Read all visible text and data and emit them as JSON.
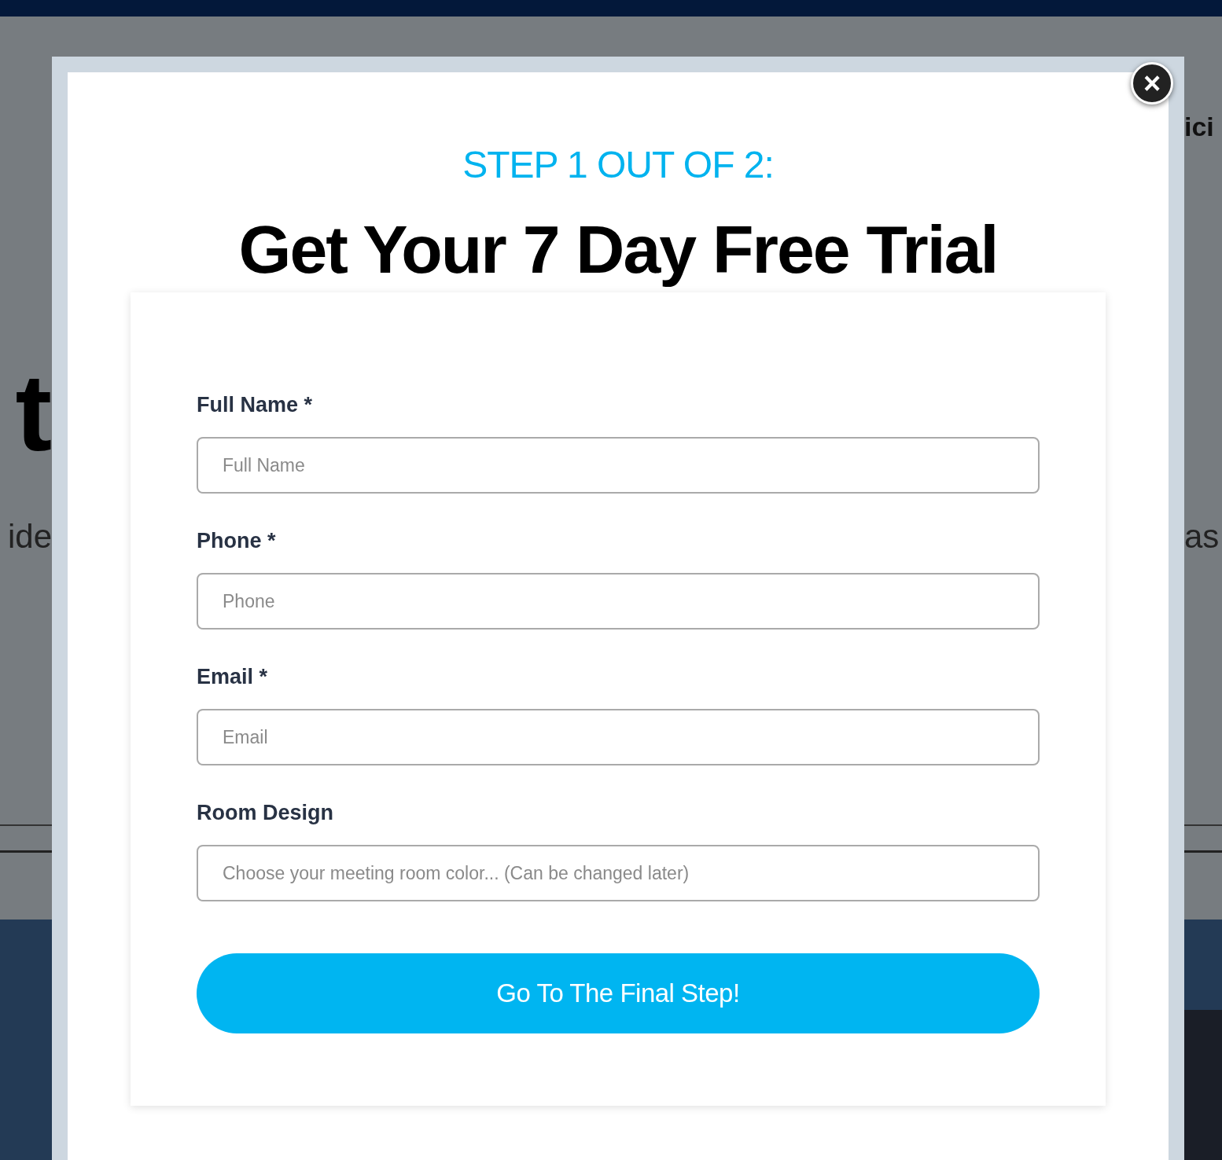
{
  "background_page": {
    "left_fragments": [
      {
        "kind": "headline",
        "text": "t"
      },
      {
        "kind": "body",
        "text": "ide"
      }
    ],
    "right_fragments": [
      {
        "kind": "nav",
        "text": "ici"
      },
      {
        "kind": "body",
        "text": "as"
      }
    ]
  },
  "modal": {
    "close": "×",
    "step": "STEP 1 OUT OF 2:",
    "title": "Get Your 7 Day Free Trial",
    "fields": [
      {
        "label": "Full Name *",
        "placeholder": "Full Name"
      },
      {
        "label": "Phone *",
        "placeholder": "Phone"
      },
      {
        "label": "Email *",
        "placeholder": "Email"
      },
      {
        "label": "Room Design",
        "placeholder": "Choose your meeting room color... (Can be changed later)"
      }
    ],
    "submit": "Go To The Final Step!"
  }
}
